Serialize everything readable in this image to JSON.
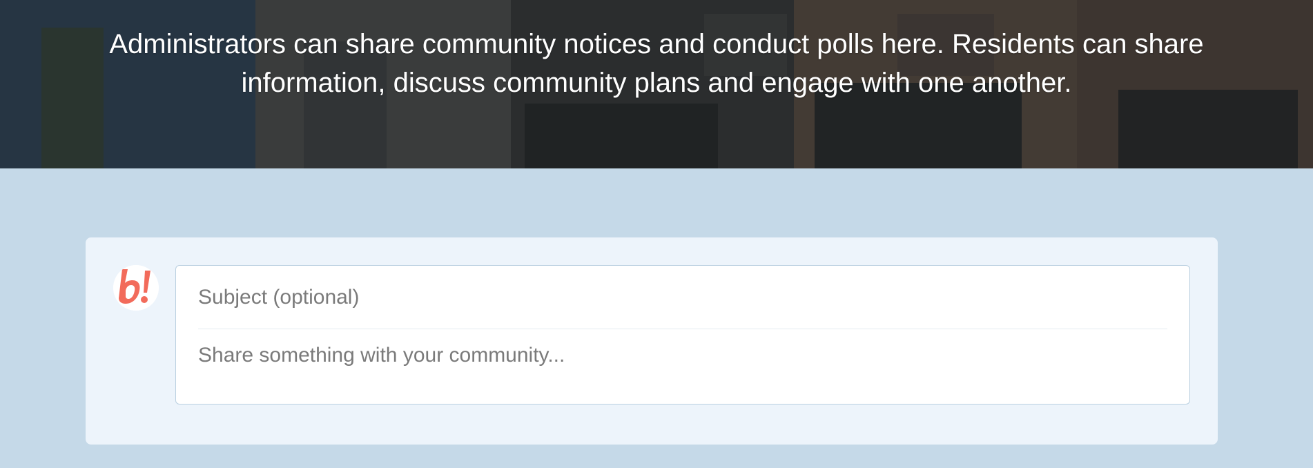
{
  "hero": {
    "description": "Administrators can share community notices and conduct polls here. Residents can share information, discuss community plans and engage with one another."
  },
  "composer": {
    "subject_placeholder": "Subject (optional)",
    "body_placeholder": "Share something with your community...",
    "logo_icon": "b-exclaim-logo-icon"
  },
  "colors": {
    "page_background": "#c5d9e8",
    "card_background": "#edf4fb",
    "logo_accent": "#f26b5b"
  }
}
